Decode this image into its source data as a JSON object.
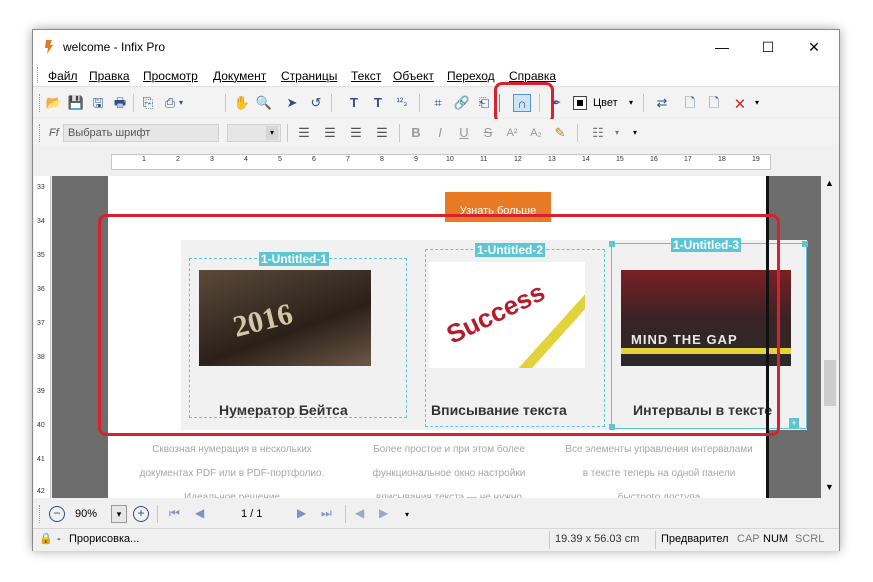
{
  "window": {
    "title": "welcome - Infix Pro",
    "minimize": "—",
    "maximize": "☐",
    "close": "✕"
  },
  "menu": [
    "Файл",
    "Правка",
    "Просмотр",
    "Документ",
    "Страницы",
    "Текст",
    "Объект",
    "Переход",
    "Справка"
  ],
  "toolbar1": {
    "color_label": "Цвет",
    "accent_highlight": "#d9202f"
  },
  "toolbar2": {
    "font_placeholder": "Выбрать шрифт",
    "font_prefix": "Ff"
  },
  "ruler": {
    "h_labels": [
      "1",
      "2",
      "3",
      "4",
      "5",
      "6",
      "7",
      "8",
      "9",
      "10",
      "11",
      "12",
      "13",
      "14",
      "15",
      "16",
      "17",
      "18",
      "19"
    ],
    "v_labels": [
      "33",
      "34",
      "35",
      "36",
      "37",
      "38",
      "39",
      "40",
      "41",
      "42"
    ]
  },
  "document": {
    "learn_more": "Узнать больше",
    "cards": [
      {
        "tag": "1-Untitled-1",
        "image_text": "2016",
        "title": "Нумератор Бейтса",
        "desc": "Сквозная нумерация в нескольких документах PDF или в PDF-портфолио. Идеальное решение"
      },
      {
        "tag": "1-Untitled-2",
        "image_text": "Success",
        "title": "Вписывание текста",
        "desc": "Более простое и при этом более функциональное окно настройки вписывания текста — не нужно"
      },
      {
        "tag": "1-Untitled-3",
        "image_text": "MIND THE GAP",
        "title": "Интервалы в тексте",
        "desc": "Все элементы управления интервалами в тексте теперь на одной панели быстрого доступа"
      }
    ]
  },
  "navigation": {
    "zoom": "90%",
    "page": "1 / 1"
  },
  "status": {
    "text": "Прорисовка...",
    "dimensions": "19.39 x 56.03 cm",
    "mode": "Предварител",
    "cap": "CAP",
    "num": "NUM",
    "scrl": "SCRL"
  }
}
